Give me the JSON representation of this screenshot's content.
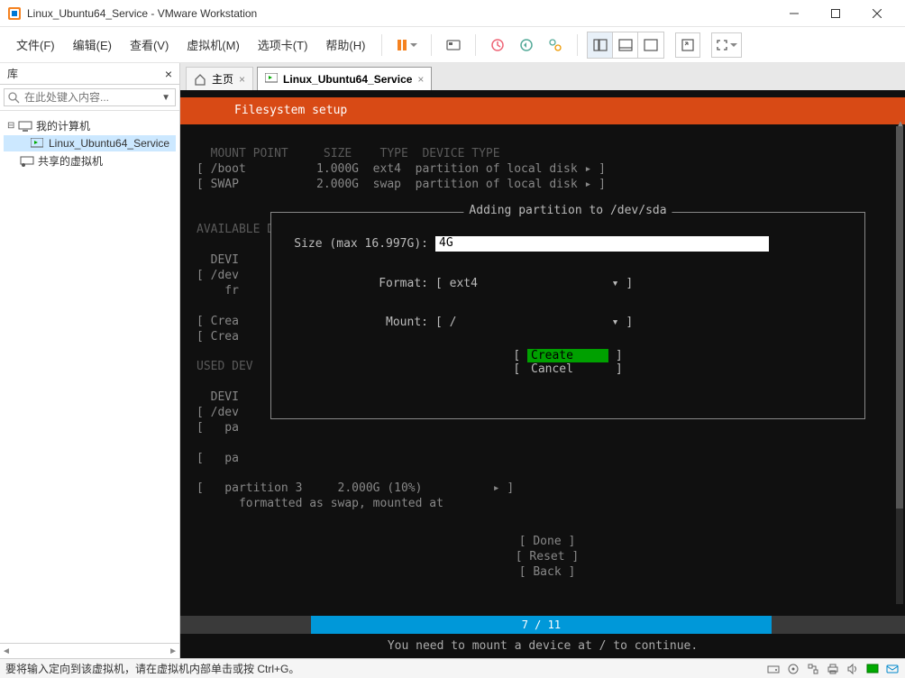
{
  "window": {
    "title": "Linux_Ubuntu64_Service - VMware Workstation"
  },
  "menu": {
    "file": "文件(F)",
    "edit": "编辑(E)",
    "view": "查看(V)",
    "vm": "虚拟机(M)",
    "tabs": "选项卡(T)",
    "help": "帮助(H)"
  },
  "sidebar": {
    "title": "库",
    "search_placeholder": "在此处键入内容...",
    "root": "我的计算机",
    "vm_item": "Linux_Ubuntu64_Service",
    "shared": "共享的虚拟机"
  },
  "tabs": {
    "home": "主页",
    "vm": "Linux_Ubuntu64_Service"
  },
  "installer": {
    "banner": "Filesystem setup",
    "cols": "  MOUNT POINT     SIZE    TYPE  DEVICE TYPE",
    "row1": "[ /boot          1.000G  ext4  partition of local disk ▸ ]",
    "row2": "[ SWAP           2.000G  swap  partition of local disk ▸ ]",
    "avail_hdr": "AVAILABLE DEVICES",
    "devi": "  DEVI",
    "dev": "[ /dev",
    "fr": "    fr",
    "crea1": "[ Crea",
    "crea2": "[ Crea",
    "used_hdr": "USED DEV",
    "devi2": "  DEVI",
    "dev2": "[ /dev",
    "pa1": "[   pa",
    "pa2": "[   pa",
    "part3": "[   partition 3     2.000G (10%)          ▸ ]",
    "part3b": "      formatted as swap, mounted at",
    "done": "[ Done       ]",
    "reset": "[ Reset      ]",
    "back": "[ Back       ]",
    "dialog_title": "Adding partition to /dev/sda",
    "size_label": "Size (max 16.997G):",
    "size_value": "4G",
    "format_label": "Format:",
    "format_value": "ext4",
    "mount_label": "Mount:",
    "mount_value": "/",
    "create": "Create",
    "cancel": "Cancel",
    "progress_text": "7 / 11",
    "footer_msg": "You need to mount a device at / to continue."
  },
  "statusbar": {
    "text": "要将输入定向到该虚拟机，请在虚拟机内部单击或按 Ctrl+G。"
  }
}
